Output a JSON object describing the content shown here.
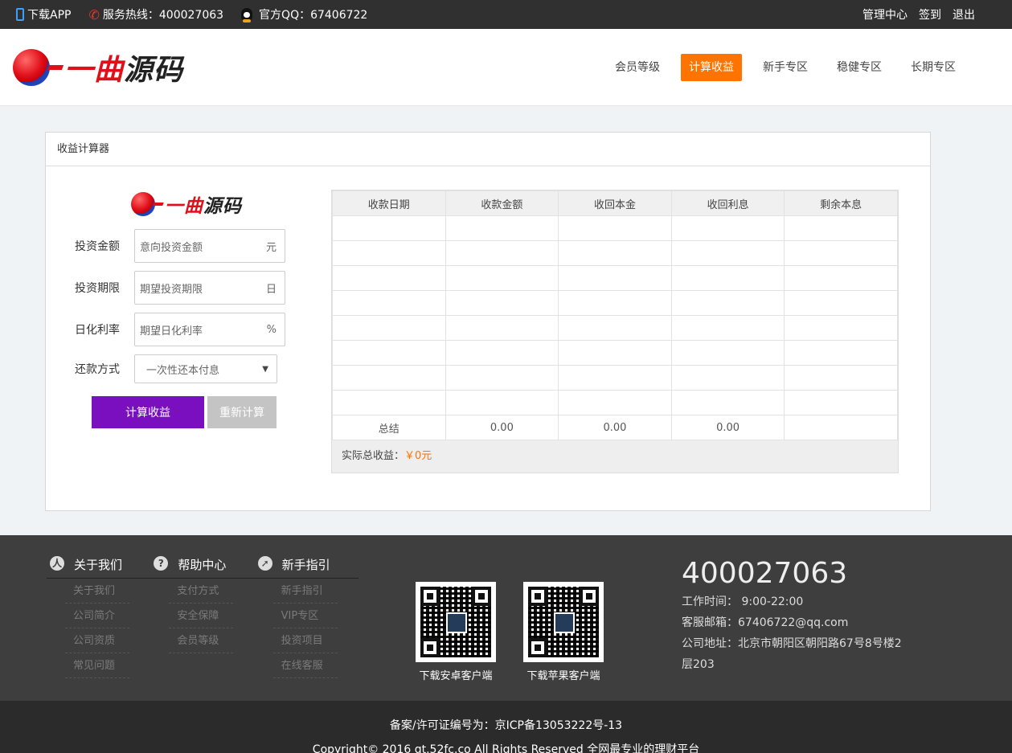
{
  "topbar": {
    "download_app": "下载APP",
    "hotline": "服务热线：400027063",
    "qq": "官方QQ：67406722",
    "links": [
      "管理中心",
      "签到",
      "退出"
    ]
  },
  "header": {
    "logo_part1": "一曲",
    "logo_part2": "源码",
    "nav": [
      "会员等级",
      "计算收益",
      "新手专区",
      "稳健专区",
      "长期专区"
    ],
    "active_nav": "计算收益"
  },
  "calculator": {
    "title": "收益计算器",
    "fields": [
      {
        "label": "投资金额",
        "placeholder": "意向投资金额",
        "unit": "元"
      },
      {
        "label": "投资期限",
        "placeholder": "期望投资期限",
        "unit": "日"
      },
      {
        "label": "日化利率",
        "placeholder": "期望日化利率",
        "unit": "%"
      }
    ],
    "repay_label": "还款方式",
    "repay_value": "一次性还本付息",
    "calc_button": "计算收益",
    "reset_button": "重新计算",
    "table": {
      "headers": [
        "收款日期",
        "收款金额",
        "收回本金",
        "收回利息",
        "剩余本息"
      ],
      "total_label": "总结",
      "totals": [
        "0.00",
        "0.00",
        "0.00",
        ""
      ],
      "actual_label": "实际总收益：",
      "actual_value": "￥0元"
    }
  },
  "footer": {
    "sections": [
      {
        "title": "关于我们",
        "icon": "user-icon",
        "glyph": "人",
        "links": [
          "关于我们",
          "公司简介",
          "公司资质",
          "常见问题"
        ]
      },
      {
        "title": "帮助中心",
        "icon": "help-icon",
        "glyph": "?",
        "links": [
          "支付方式",
          "安全保障",
          "会员等级"
        ]
      },
      {
        "title": "新手指引",
        "icon": "compass-icon",
        "glyph": "➚",
        "links": [
          "新手指引",
          "VIP专区",
          "投资项目",
          "在线客服"
        ]
      }
    ],
    "qr_android": "下载安卓客户端",
    "qr_ios": "下载苹果客户端",
    "phone": "400027063",
    "hours": "工作时间：  9:00-22:00",
    "email": "客服邮箱：67406722@qq.com",
    "address": "公司地址：北京市朝阳区朝阳路67号8号楼2层203",
    "icp": "备案/许可证编号为：京ICP备13053222号-13",
    "copyright": "Copyright© 2016 qt.52fc.co All Rights Reserved 全网最专业的理财平台"
  }
}
